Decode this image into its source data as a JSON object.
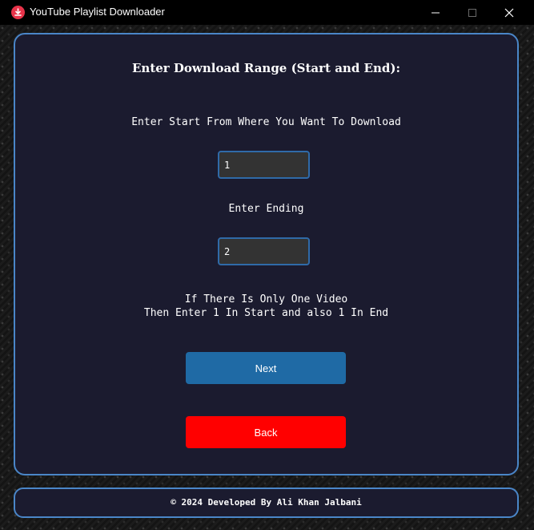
{
  "window": {
    "title": "YouTube Playlist Downloader",
    "app_icon": "youtube-download-icon",
    "controls": [
      "minimize-icon",
      "maximize-icon",
      "close-icon"
    ]
  },
  "main": {
    "heading": "Enter Download Range (Start and End):",
    "start_label": "Enter Start From Where You Want To Download",
    "start_value": "1",
    "end_label": "Enter Ending",
    "end_value": "2",
    "note_line1": "If There Is Only One Video",
    "note_line2": "Then Enter 1 In Start and also 1 In End",
    "next_label": "Next",
    "back_label": "Back"
  },
  "footer": {
    "text": "© 2024 Developed By Ali Khan Jalbani"
  },
  "colors": {
    "panel_bg": "#1b1b2f",
    "panel_border": "#4a86c8",
    "next_button": "#1f6aa5",
    "back_button": "#ff0000",
    "input_bg": "#333333"
  }
}
